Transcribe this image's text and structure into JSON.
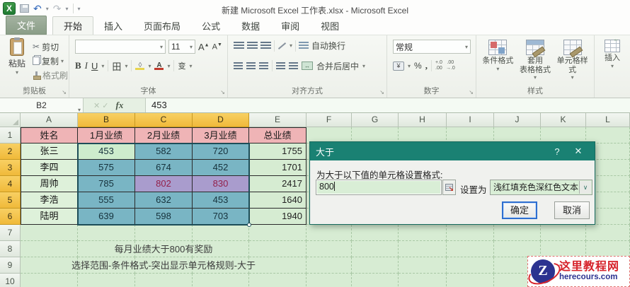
{
  "window": {
    "title": "新建 Microsoft Excel 工作表.xlsx - Microsoft Excel"
  },
  "tabs": {
    "file": "文件",
    "items": [
      "开始",
      "插入",
      "页面布局",
      "公式",
      "数据",
      "审阅",
      "视图"
    ]
  },
  "ribbon": {
    "clipboard": {
      "group_label": "剪贴板",
      "paste": "粘贴",
      "cut": "剪切",
      "copy": "复制",
      "format_painter": "格式刷"
    },
    "font": {
      "group_label": "字体",
      "size": "11",
      "bold": "B",
      "italic": "I",
      "underline": "U",
      "border_icon": "田",
      "pinyin": "变"
    },
    "alignment": {
      "group_label": "对齐方式",
      "wrap_text": "自动换行",
      "merge_center": "合并后居中"
    },
    "number": {
      "group_label": "数字",
      "format": "常规",
      "currency": "¥",
      "percent": "%",
      "comma": ","
    },
    "styles": {
      "group_label": "样式",
      "conditional": "条件格式",
      "format_table_line1": "套用",
      "format_table_line2": "表格格式",
      "cell_styles": "单元格样式"
    },
    "insert": {
      "label": "插入"
    }
  },
  "formula_bar": {
    "name_box": "B2",
    "fx": "fx",
    "value": "453"
  },
  "sheet": {
    "column_headers": [
      "A",
      "B",
      "C",
      "D",
      "E",
      "F",
      "G",
      "H",
      "I",
      "J",
      "K",
      "L"
    ],
    "row_headers": [
      "1",
      "2",
      "3",
      "4",
      "5",
      "6",
      "7",
      "8",
      "9",
      "10"
    ],
    "selected_columns": [
      "B",
      "C",
      "D"
    ],
    "selected_rows": [
      "2",
      "3",
      "4",
      "5",
      "6"
    ],
    "table_headers": [
      "姓名",
      "1月业绩",
      "2月业绩",
      "3月业绩",
      "总业绩"
    ],
    "table_rows": [
      [
        "张三",
        "453",
        "582",
        "720",
        "1755"
      ],
      [
        "李四",
        "575",
        "674",
        "452",
        "1701"
      ],
      [
        "周帅",
        "785",
        "802",
        "830",
        "2417"
      ],
      [
        "李浩",
        "555",
        "632",
        "453",
        "1640"
      ],
      [
        "陆明",
        "639",
        "598",
        "703",
        "1940"
      ]
    ],
    "active_cell": "B2",
    "highlighted_cells": [
      "C4",
      "D4"
    ],
    "note_row8": "每月业绩大于800有奖励",
    "note_row9": "选择范围-条件格式-突出显示单元格规则-大于"
  },
  "dialog": {
    "title": "大于",
    "help_button": "?",
    "close_button": "✕",
    "prompt": "为大于以下值的单元格设置格式:",
    "value": "800",
    "with_label": "设置为",
    "format_option": "浅红填充色深红色文本",
    "ok": "确定",
    "cancel": "取消"
  },
  "watermark": {
    "logo_letter": "Z",
    "site_name": "这里教程网",
    "site_url": "herecours.com"
  },
  "colors": {
    "dialog_titlebar": "#1a8173",
    "selection_fill": "#79b5c4",
    "active_cell_fill": "#cdeccd",
    "conditional_fill": "#a99ccd",
    "conditional_text": "#93204a",
    "header_pink": "#efb4b6",
    "name_green": "#def1da",
    "total_green": "#d6ecd2",
    "selected_header_gold": "#f4c344",
    "sheet_green": "#d7ecd3",
    "logo_red": "#d6232b",
    "logo_blue": "#2c3390"
  }
}
